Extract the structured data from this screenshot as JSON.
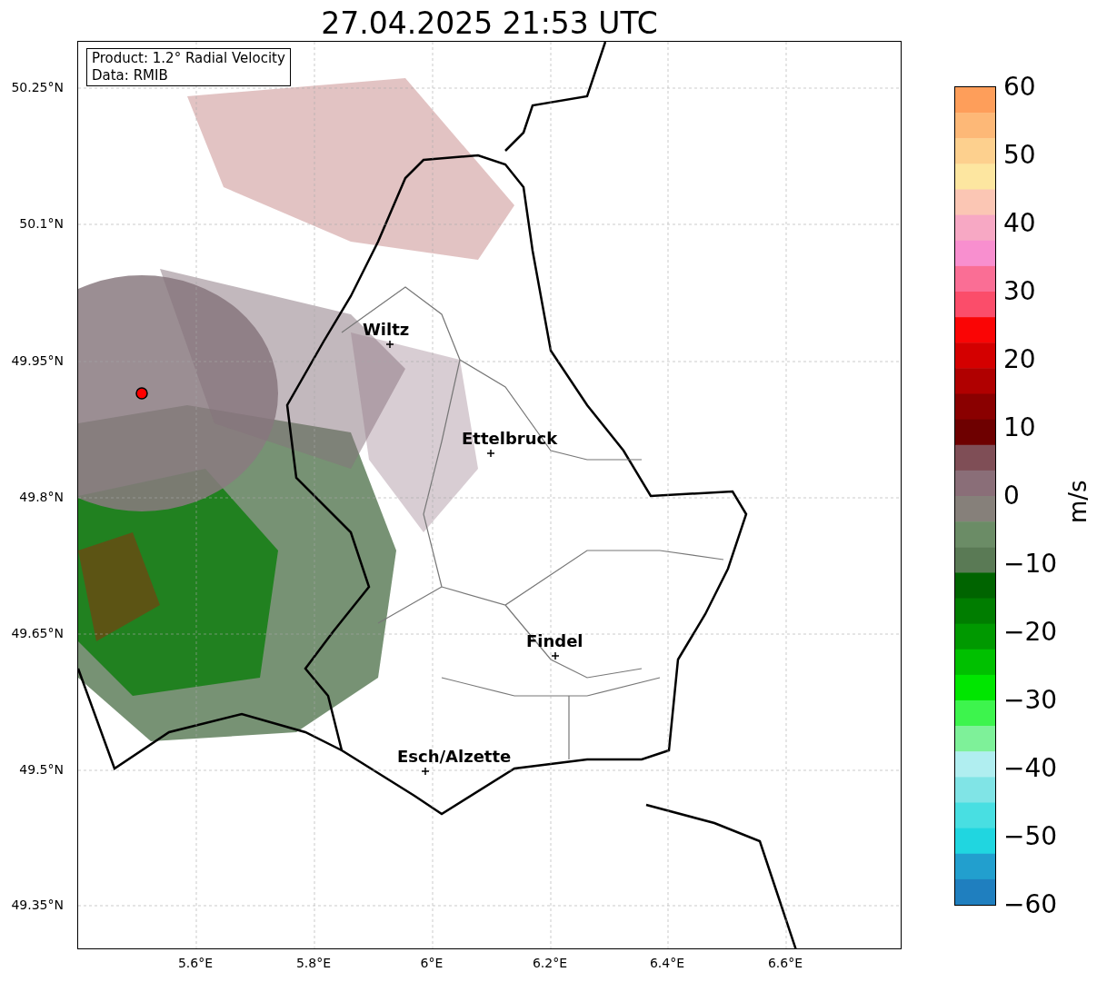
{
  "title": "27.04.2025 21:53 UTC",
  "legend": [
    "Product: 1.2° Radial Velocity",
    "Data: RMIB"
  ],
  "map": {
    "lat_ticks": [
      "50.25°N",
      "50.1°N",
      "49.95°N",
      "49.8°N",
      "49.65°N",
      "49.5°N",
      "49.35°N"
    ],
    "lon_ticks": [
      "5.6°E",
      "5.8°E",
      "6°E",
      "6.2°E",
      "6.4°E",
      "6.6°E"
    ],
    "places": [
      {
        "name": "Wiltz"
      },
      {
        "name": "Ettelbruck"
      },
      {
        "name": "Findel"
      },
      {
        "name": "Esch/Alzette"
      }
    ]
  },
  "colorbar": {
    "label": "m/s",
    "ticks": [
      "60",
      "50",
      "40",
      "30",
      "20",
      "10",
      "0",
      "−10",
      "−20",
      "−30",
      "−40",
      "−50",
      "−60"
    ]
  }
}
